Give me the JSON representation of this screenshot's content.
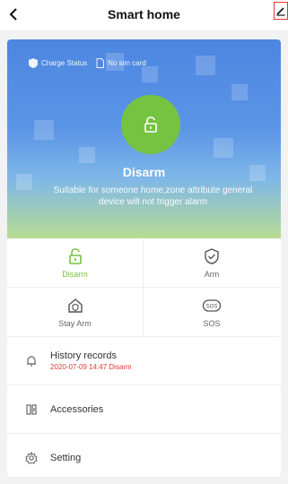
{
  "header": {
    "title": "Smart home"
  },
  "status": {
    "charge": "Charge Status",
    "sim": "No sim card"
  },
  "hero": {
    "mode": "Disarm",
    "description": "Suitable for someone home,zone attribute general device will not trigger alarm",
    "accent": "#76c342"
  },
  "modes": [
    {
      "label": "Disarm",
      "active": true
    },
    {
      "label": "Arm"
    },
    {
      "label": "Stay Arm"
    },
    {
      "label": "SOS"
    }
  ],
  "sos_icon_text": "SOS",
  "menu": {
    "history": {
      "label": "History records",
      "latest": "2020-07-09 14:47 Disarm"
    },
    "accessories": {
      "label": "Accessories"
    },
    "setting": {
      "label": "Setting"
    }
  }
}
